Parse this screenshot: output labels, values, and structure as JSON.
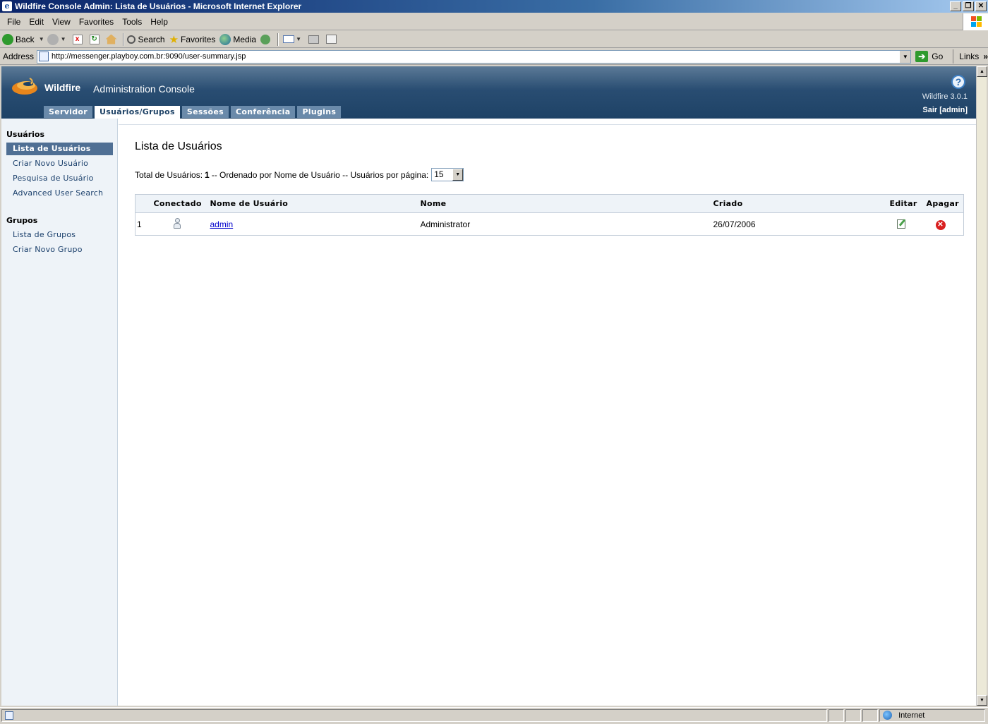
{
  "window": {
    "title": "Wildfire Console Admin: Lista de Usuários - Microsoft Internet Explorer",
    "controls": [
      "_",
      "❐",
      "✕"
    ]
  },
  "menu": [
    "File",
    "Edit",
    "View",
    "Favorites",
    "Tools",
    "Help"
  ],
  "toolbar": {
    "back": "Back",
    "search": "Search",
    "favorites": "Favorites",
    "media": "Media"
  },
  "address": {
    "label": "Address",
    "url": "http://messenger.playboy.com.br:9090/user-summary.jsp",
    "go": "Go",
    "links": "Links"
  },
  "header": {
    "brand": "Wildfire",
    "console": "Administration Console",
    "version": "Wildfire 3.0.1",
    "logout": "Sair [admin]",
    "tabs": [
      {
        "label": "Servidor",
        "active": false
      },
      {
        "label": "Usuários/Grupos",
        "active": true
      },
      {
        "label": "Sessões",
        "active": false
      },
      {
        "label": "Conferência",
        "active": false
      },
      {
        "label": "Plugins",
        "active": false
      }
    ]
  },
  "sidebar": {
    "sections": [
      {
        "title": "Usuários",
        "items": [
          "Lista de Usuários",
          "Criar Novo Usuário",
          "Pesquisa de Usuário",
          "Advanced User Search"
        ]
      },
      {
        "title": "Grupos",
        "items": [
          "Lista de Grupos",
          "Criar Novo Grupo"
        ]
      }
    ],
    "active_item": "Lista de Usuários"
  },
  "main": {
    "title": "Lista de Usuários",
    "summary_prefix": "Total de Usuários:",
    "total": "1",
    "summary_middle": "-- Ordenado por Nome de Usuário -- Usuários por página:",
    "per_page": "15",
    "table": {
      "headers": [
        "",
        "Conectado",
        "Nome de Usuário",
        "Nome",
        "Criado",
        "Editar",
        "Apagar"
      ],
      "rows": [
        {
          "index": "1",
          "username": "admin",
          "name": "Administrator",
          "created": "26/07/2006"
        }
      ]
    }
  },
  "status": {
    "zone": "Internet"
  },
  "colors": {
    "header_dark": "#1e4266",
    "sidebar_active": "#4f6f94",
    "link": "#0000cc"
  }
}
